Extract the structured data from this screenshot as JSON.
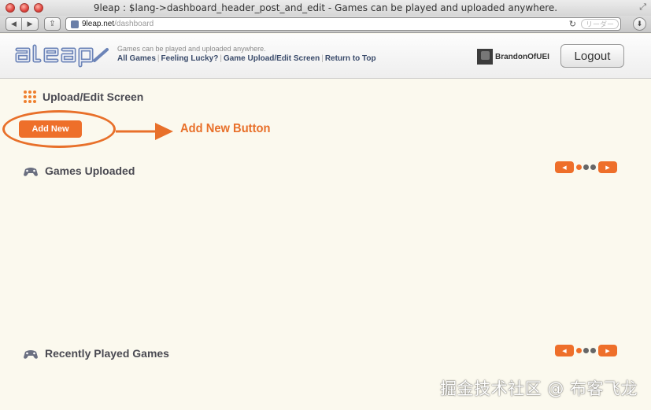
{
  "window": {
    "title": "9leap : $lang->dashboard_header_post_and_edit - Games can be played and uploaded anywhere."
  },
  "toolbar": {
    "url_host": "9leap.net",
    "url_path": "/dashboard",
    "reader_label": "リーダー"
  },
  "header": {
    "tagline": "Games can be played and uploaded anywhere.",
    "nav_links": [
      "All Games",
      "Feeling Lucky?",
      "Game Upload/Edit Screen",
      "Return to Top"
    ],
    "username": "BrandonOfUEI",
    "logout_label": "Logout"
  },
  "main": {
    "page_title": "Upload/Edit Screen",
    "add_new_label": "Add New",
    "callout_text": "Add New Button",
    "sections": [
      {
        "title": "Games Uploaded"
      },
      {
        "title": "Recently Played Games"
      }
    ]
  },
  "watermark": "掘金技术社区 @ 布客飞龙",
  "colors": {
    "accent": "#ee6f2a",
    "background": "#fbf9ee",
    "nav_link": "#3a4b6b"
  }
}
